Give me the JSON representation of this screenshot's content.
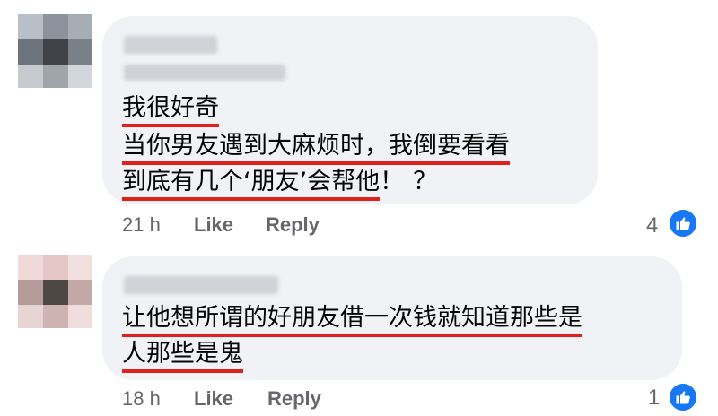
{
  "comments": [
    {
      "lines": [
        {
          "underlined": "我很好奇",
          "tail": ""
        },
        {
          "underlined": "当你男友遇到大麻烦时，我倒要看看",
          "tail": ""
        },
        {
          "underlined": "到底有几个‘朋友’会帮他",
          "tail": "！？"
        }
      ],
      "time": "21 h",
      "like_label": "Like",
      "reply_label": "Reply",
      "reaction_count": "4",
      "reaction_icon": "thumbs-up-icon"
    },
    {
      "lines": [
        {
          "underlined": "让他想所谓的好朋友借一次钱就知道那些是",
          "tail": ""
        },
        {
          "underlined": "人那些是鬼",
          "tail": ""
        }
      ],
      "time": "18 h",
      "like_label": "Like",
      "reply_label": "Reply",
      "reaction_count": "1",
      "reaction_icon": "thumbs-up-icon"
    }
  ],
  "colors": {
    "bubble": "#f0f2f5",
    "underline": "#e0211b",
    "meta": "#65676b",
    "reaction": "#1877f2"
  }
}
